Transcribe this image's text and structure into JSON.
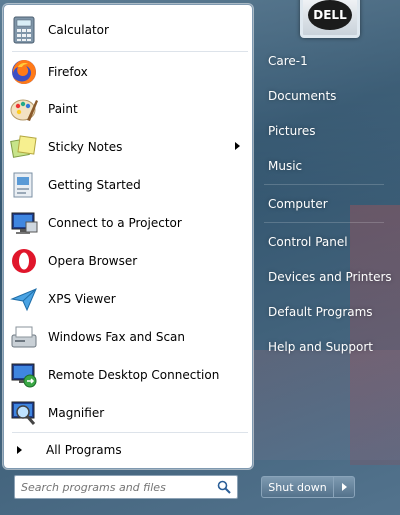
{
  "programs": [
    {
      "label": "Calculator",
      "icon": "calculator-icon",
      "has_submenu": false
    },
    {
      "label": "Firefox",
      "icon": "firefox-icon",
      "has_submenu": false
    },
    {
      "label": "Paint",
      "icon": "paint-icon",
      "has_submenu": false
    },
    {
      "label": "Sticky Notes",
      "icon": "sticky-notes-icon",
      "has_submenu": true
    },
    {
      "label": "Getting Started",
      "icon": "getting-started-icon",
      "has_submenu": false
    },
    {
      "label": "Connect to a Projector",
      "icon": "projector-icon",
      "has_submenu": false
    },
    {
      "label": "Opera Browser",
      "icon": "opera-icon",
      "has_submenu": false
    },
    {
      "label": "XPS Viewer",
      "icon": "xps-viewer-icon",
      "has_submenu": false
    },
    {
      "label": "Windows Fax and Scan",
      "icon": "fax-scan-icon",
      "has_submenu": false
    },
    {
      "label": "Remote Desktop Connection",
      "icon": "remote-desktop-icon",
      "has_submenu": false
    },
    {
      "label": "Magnifier",
      "icon": "magnifier-icon",
      "has_submenu": false
    }
  ],
  "all_programs_label": "All Programs",
  "search": {
    "placeholder": "Search programs and files",
    "icon": "search-icon"
  },
  "right_items": [
    {
      "label": "Care-1"
    },
    {
      "label": "Documents"
    },
    {
      "label": "Pictures"
    },
    {
      "label": "Music"
    },
    {
      "label": "Computer"
    },
    {
      "label": "Control Panel"
    },
    {
      "label": "Devices and Printers"
    },
    {
      "label": "Default Programs"
    },
    {
      "label": "Help and Support"
    }
  ],
  "shutdown_label": "Shut down",
  "avatar_text": "DELL",
  "colors": {
    "panel_bg": "#ffffff",
    "glass": "#3c5d74",
    "text_light": "#ffffff"
  }
}
